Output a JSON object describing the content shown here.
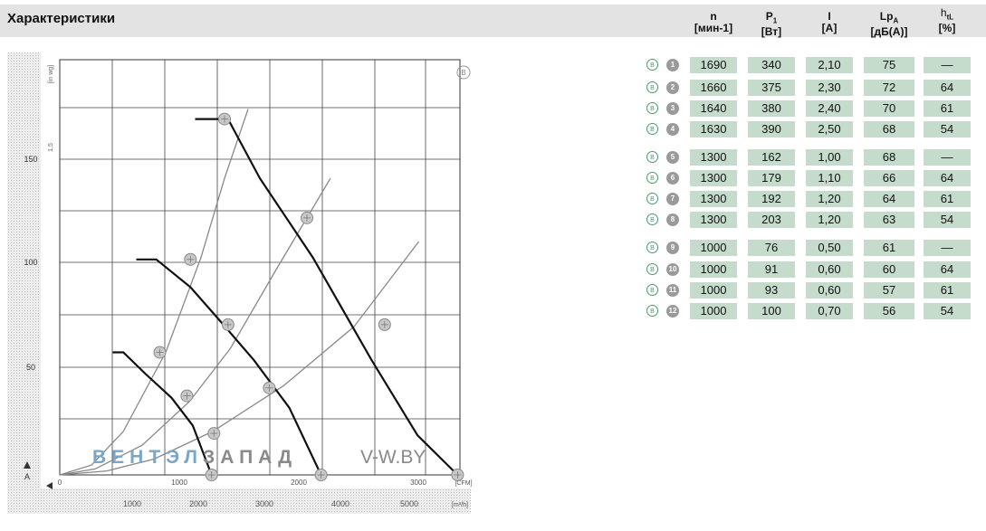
{
  "header": {
    "title": "Характеристики",
    "columns": [
      {
        "symbol": "n",
        "sub": "",
        "unit": "[мин-1]"
      },
      {
        "symbol": "P",
        "sub": "1",
        "unit": "[Вт]"
      },
      {
        "symbol": "I",
        "sub": "",
        "unit": "[A]"
      },
      {
        "symbol": "Lp",
        "sub": "A",
        "unit": "[дБ(A)]"
      },
      {
        "symbol": "h",
        "sub": "tL",
        "unit": "[%]"
      }
    ]
  },
  "rows": [
    {
      "mark": "B",
      "num": "1",
      "n": "1690",
      "p1": "340",
      "i": "2,10",
      "lpa": "75",
      "eta": "—"
    },
    {
      "mark": "B",
      "num": "2",
      "n": "1660",
      "p1": "375",
      "i": "2,30",
      "lpa": "72",
      "eta": "64"
    },
    {
      "mark": "B",
      "num": "3",
      "n": "1640",
      "p1": "380",
      "i": "2,40",
      "lpa": "70",
      "eta": "61"
    },
    {
      "mark": "B",
      "num": "4",
      "n": "1630",
      "p1": "390",
      "i": "2,50",
      "lpa": "68",
      "eta": "54"
    },
    {
      "mark": "B",
      "num": "5",
      "n": "1300",
      "p1": "162",
      "i": "1,00",
      "lpa": "68",
      "eta": "—"
    },
    {
      "mark": "B",
      "num": "6",
      "n": "1300",
      "p1": "179",
      "i": "1,10",
      "lpa": "66",
      "eta": "64"
    },
    {
      "mark": "B",
      "num": "7",
      "n": "1300",
      "p1": "192",
      "i": "1,20",
      "lpa": "64",
      "eta": "61"
    },
    {
      "mark": "B",
      "num": "8",
      "n": "1300",
      "p1": "203",
      "i": "1,20",
      "lpa": "63",
      "eta": "54"
    },
    {
      "mark": "B",
      "num": "9",
      "n": "1000",
      "p1": "76",
      "i": "0,50",
      "lpa": "61",
      "eta": "—"
    },
    {
      "mark": "B",
      "num": "10",
      "n": "1000",
      "p1": "91",
      "i": "0,60",
      "lpa": "60",
      "eta": "64"
    },
    {
      "mark": "B",
      "num": "11",
      "n": "1000",
      "p1": "93",
      "i": "0,60",
      "lpa": "57",
      "eta": "61"
    },
    {
      "mark": "B",
      "num": "12",
      "n": "1000",
      "p1": "100",
      "i": "0,70",
      "lpa": "56",
      "eta": "54"
    }
  ],
  "watermark": {
    "left": "ВЕНТЭЛЗАПАД",
    "right": "V-W.BY",
    "left_color": "#7aa6c8",
    "left_dark_color": "#8a8a8a"
  },
  "colors": {
    "header_bg": "#e3e3e3",
    "cell_bg": "#c5dccd",
    "marker": "#9a9a9a",
    "curve": "#111111",
    "grid": "#333333"
  },
  "chart_data": {
    "type": "line",
    "title": "",
    "xlabel": "",
    "ylabel": "",
    "x_unit_primary": "[CFM]",
    "x_unit_secondary": "[m³/h]",
    "xlim": [
      0,
      3400
    ],
    "ylim": [
      0,
      210
    ],
    "x_ticks_primary": [
      "0",
      "1000",
      "2000",
      "3000"
    ],
    "x_ticks_secondary": [
      "1000",
      "2000",
      "3000",
      "4000",
      "5000"
    ],
    "y_ticks_left": [
      "50",
      "100",
      "150"
    ],
    "y_ticks_inner": [
      "1,5"
    ],
    "y_label_top": "[in wg]",
    "annotation": "B",
    "grid": true,
    "series": [
      {
        "x": [
          1150,
          1250,
          1430,
          1700,
          2150,
          2650,
          3040,
          3380
        ],
        "y": [
          180,
          180,
          180,
          150,
          110,
          58,
          20,
          0
        ]
      },
      {
        "x": [
          650,
          820,
          1110,
          1390,
          1650,
          1950,
          2220
        ],
        "y": [
          109,
          109,
          95,
          76,
          58,
          34,
          0
        ]
      },
      {
        "x": [
          450,
          540,
          730,
          950,
          1130,
          1290
        ],
        "y": [
          62,
          62,
          51,
          39,
          25,
          0
        ]
      }
    ],
    "system_lines": [
      {
        "x": [
          0,
          270,
          540,
          900,
          1200,
          1400,
          1600
        ],
        "y": [
          0,
          5,
          22,
          62,
          110,
          150,
          185
        ]
      },
      {
        "x": [
          0,
          300,
          700,
          1100,
          1450,
          1850,
          2300
        ],
        "y": [
          0,
          3,
          15,
          37,
          64,
          105,
          150
        ]
      },
      {
        "x": [
          0,
          400,
          800,
          1300,
          1900,
          2500,
          3050
        ],
        "y": [
          0,
          2,
          8,
          22,
          45,
          75,
          118
        ]
      }
    ],
    "markers": [
      {
        "label": "1",
        "x": 1400,
        "y": 180
      },
      {
        "label": "2",
        "x": 2100,
        "y": 130
      },
      {
        "label": "3",
        "x": 2760,
        "y": 76
      },
      {
        "label": "4",
        "x": 3380,
        "y": 0
      },
      {
        "label": "5",
        "x": 1110,
        "y": 109
      },
      {
        "label": "6",
        "x": 1430,
        "y": 76
      },
      {
        "label": "7",
        "x": 1780,
        "y": 44
      },
      {
        "label": "8",
        "x": 2220,
        "y": 0
      },
      {
        "label": "9",
        "x": 850,
        "y": 62
      },
      {
        "label": "10",
        "x": 1080,
        "y": 40
      },
      {
        "label": "11",
        "x": 1310,
        "y": 21
      },
      {
        "label": "12",
        "x": 1290,
        "y": 0
      }
    ]
  }
}
